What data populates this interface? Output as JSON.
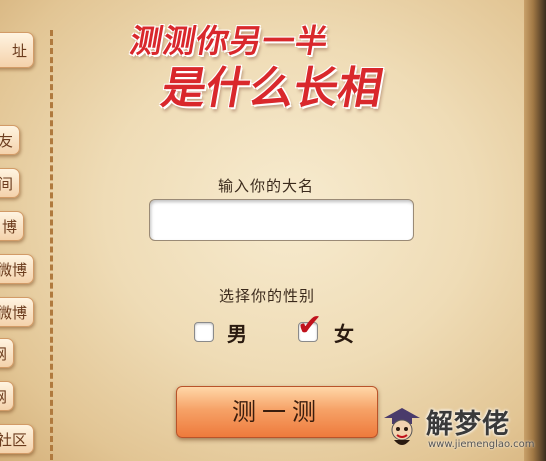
{
  "sidebar": {
    "items": [
      {
        "label": "址"
      },
      {
        "label": "友"
      },
      {
        "label": "间"
      },
      {
        "label": "博"
      },
      {
        "label": "微博"
      },
      {
        "label": "微博"
      },
      {
        "label": "网"
      },
      {
        "label": "网"
      },
      {
        "label": "社区"
      }
    ]
  },
  "header": {
    "title_line1": "测测你另一半",
    "title_line2": "是什么长相"
  },
  "form": {
    "name_label": "输入你的大名",
    "name_value": "",
    "gender_label": "选择你的性别",
    "gender_options": [
      {
        "label": "男",
        "checked": false
      },
      {
        "label": "女",
        "checked": true
      }
    ],
    "submit_label": "测一测"
  },
  "watermark": {
    "name": "解梦佬",
    "url": "www.jiemenglao.com"
  },
  "colors": {
    "title_red": "#d9282c",
    "checkmark_red": "#c0121c",
    "button_orange": "#ee7a3c"
  }
}
